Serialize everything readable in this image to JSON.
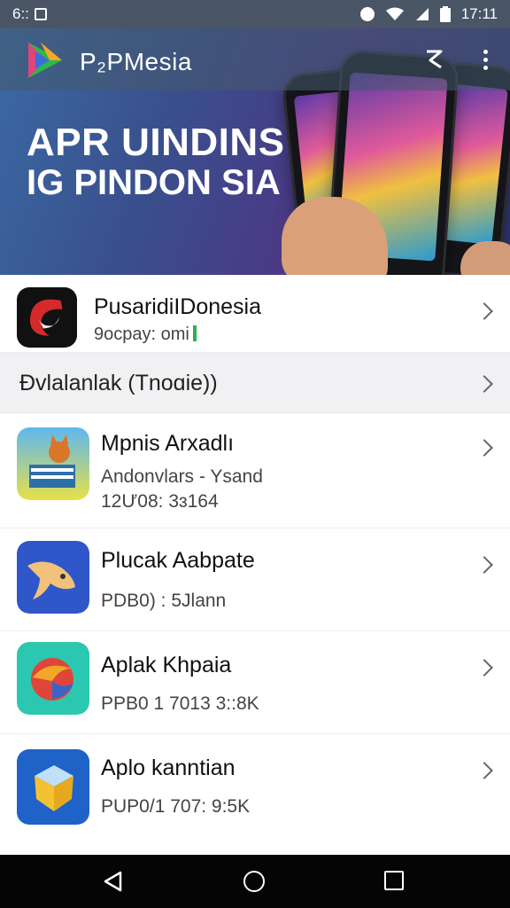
{
  "status_bar": {
    "left_text": "6::",
    "time": "17:11",
    "icons": [
      "notification-square-icon",
      "vpn-icon",
      "wifi-icon",
      "signal-icon",
      "battery-icon"
    ]
  },
  "app_bar": {
    "title": "P₂PMesia",
    "icons": [
      "app-logo-icon",
      "share-icon",
      "more-vert-icon"
    ]
  },
  "banner": {
    "line1": "APR UINDINS",
    "line2": "IG PINDON SIA"
  },
  "list": {
    "featured": {
      "title": "PusaridiIDonesia",
      "subtitle": "9ocpay: omi",
      "icon": "red-swirl-app-icon"
    },
    "section_label": "Đvlalanlak (Tnoɑie))",
    "apps": [
      {
        "title": "Mpnis Arxadlı",
        "line1": "Andonvlars - Ysand",
        "line2": "12Ư08: 3ɜ164",
        "icon": "fox-books-app-icon"
      },
      {
        "title": "Plucak Aabpate",
        "line1": "PDB0) : 5Jlann",
        "line2": "",
        "icon": "fish-app-icon"
      },
      {
        "title": "Aplak Khpaia",
        "line1": "PPB0 1 7013 3::8K",
        "line2": "",
        "icon": "swirl-ball-app-icon"
      },
      {
        "title": "Aplo kanntian",
        "line1": "PUP0/1 707: 9:5K",
        "line2": "",
        "icon": "shield-box-app-icon"
      }
    ]
  },
  "nav_bar": {
    "icons": [
      "back-icon",
      "home-icon",
      "recents-icon"
    ]
  },
  "colors": {
    "status_bar": "#4a5566",
    "banner_start": "#3b6aa3",
    "banner_end": "#2c3570",
    "section_bg": "#f1f1f3",
    "navbar": "#050505",
    "accent_green": "#2bb24c"
  }
}
